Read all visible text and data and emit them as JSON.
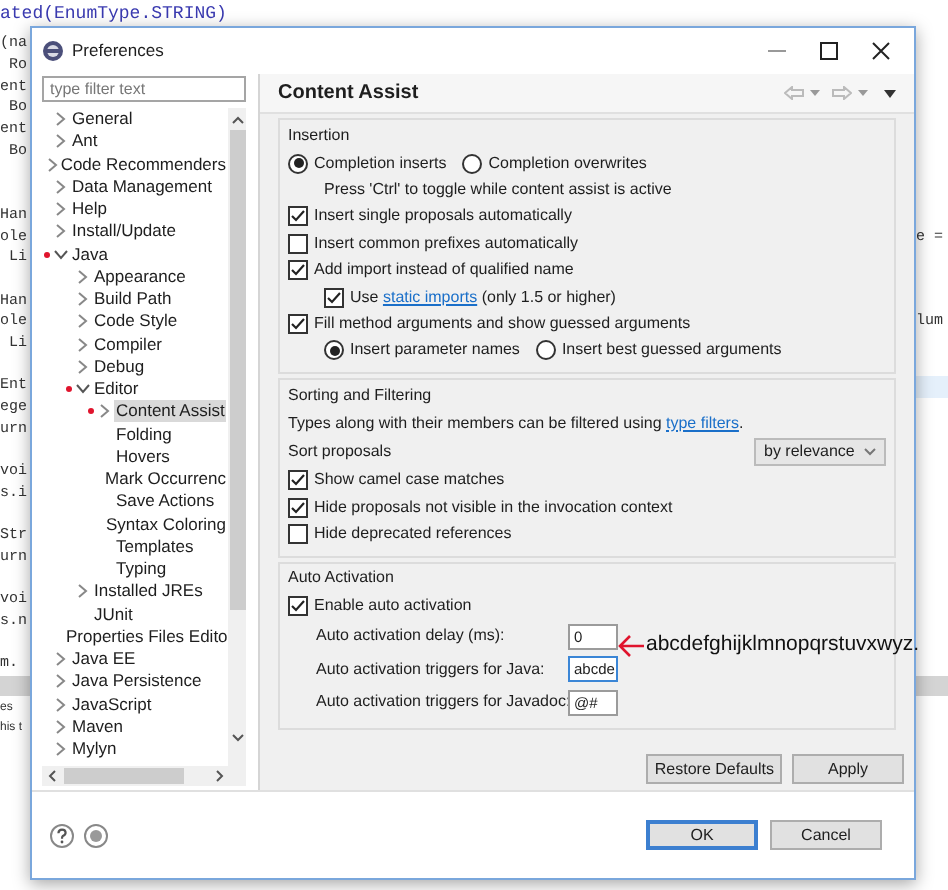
{
  "background": {
    "top_line": "ated(EnumType.STRING)",
    "left_lines": [
      {
        "kind": "code",
        "text": "(na"
      },
      {
        "kind": "code",
        "text": " Ro"
      },
      {
        "kind": "code",
        "text": "ent"
      },
      {
        "kind": "code",
        "text": " Bo"
      },
      {
        "kind": "code",
        "text": "ent"
      },
      {
        "kind": "code",
        "text": " Bo"
      },
      {
        "kind": "blank"
      },
      {
        "kind": "blank"
      },
      {
        "kind": "code",
        "text": "Han"
      },
      {
        "kind": "code",
        "text": "ole"
      },
      {
        "kind": "code",
        "text": " Li"
      },
      {
        "kind": "blank"
      },
      {
        "kind": "code",
        "text": "Han"
      },
      {
        "kind": "code",
        "text": "ole"
      },
      {
        "kind": "code",
        "text": " Li"
      },
      {
        "kind": "blank"
      },
      {
        "kind": "code",
        "text": "Ent"
      },
      {
        "kind": "code",
        "text": "ege"
      },
      {
        "kind": "code",
        "text": "urn"
      },
      {
        "kind": "blank"
      },
      {
        "kind": "code",
        "text": "voi"
      },
      {
        "kind": "code",
        "text": "s.i"
      },
      {
        "kind": "blank"
      },
      {
        "kind": "code",
        "text": "Str"
      },
      {
        "kind": "code",
        "text": "urn"
      },
      {
        "kind": "blank"
      },
      {
        "kind": "code",
        "text": "voi"
      },
      {
        "kind": "code",
        "text": "s.n"
      },
      {
        "kind": "blank"
      },
      {
        "kind": "code",
        "text": "m."
      },
      {
        "kind": "band"
      },
      {
        "kind": "ui",
        "text": "es"
      },
      {
        "kind": "ui",
        "text": "his t"
      }
    ],
    "right_lines": [
      {
        "kind": "blank"
      },
      {
        "kind": "blank"
      },
      {
        "kind": "blank"
      },
      {
        "kind": "blank"
      },
      {
        "kind": "blank"
      },
      {
        "kind": "blank"
      },
      {
        "kind": "blank"
      },
      {
        "kind": "blank"
      },
      {
        "kind": "blank"
      },
      {
        "kind": "code",
        "text": "e ="
      },
      {
        "kind": "blank"
      },
      {
        "kind": "blank"
      },
      {
        "kind": "blank"
      },
      {
        "kind": "code",
        "text": "lum"
      },
      {
        "kind": "blank"
      },
      {
        "kind": "blank"
      },
      {
        "kind": "highlight"
      },
      {
        "kind": "blank"
      },
      {
        "kind": "blank"
      },
      {
        "kind": "blank"
      },
      {
        "kind": "blank"
      },
      {
        "kind": "blank"
      },
      {
        "kind": "blank"
      },
      {
        "kind": "blank"
      },
      {
        "kind": "blank"
      },
      {
        "kind": "blank"
      },
      {
        "kind": "blank"
      },
      {
        "kind": "blank"
      },
      {
        "kind": "blank"
      },
      {
        "kind": "blank"
      },
      {
        "kind": "band"
      }
    ]
  },
  "window": {
    "title": "Preferences"
  },
  "filter": {
    "placeholder": "type filter text"
  },
  "tree": [
    {
      "label": "General",
      "has_children": true,
      "modified": false,
      "selected": false
    },
    {
      "label": "Ant",
      "has_children": true,
      "modified": false,
      "selected": false
    },
    {
      "label": "Code Recommenders",
      "has_children": true,
      "modified": false,
      "selected": false
    },
    {
      "label": "Data Management",
      "has_children": true,
      "modified": false,
      "selected": false
    },
    {
      "label": "Help",
      "has_children": true,
      "modified": false,
      "selected": false
    },
    {
      "label": "Install/Update",
      "has_children": true,
      "modified": false,
      "selected": false
    },
    {
      "label": "Java",
      "has_children": true,
      "expanded": true,
      "modified": true,
      "selected": false,
      "children": [
        {
          "label": "Appearance",
          "has_children": true,
          "modified": false,
          "selected": false
        },
        {
          "label": "Build Path",
          "has_children": true,
          "modified": false,
          "selected": false
        },
        {
          "label": "Code Style",
          "has_children": true,
          "modified": false,
          "selected": false
        },
        {
          "label": "Compiler",
          "has_children": true,
          "modified": false,
          "selected": false
        },
        {
          "label": "Debug",
          "has_children": true,
          "modified": false,
          "selected": false
        },
        {
          "label": "Editor",
          "has_children": true,
          "expanded": true,
          "modified": true,
          "selected": false,
          "children": [
            {
              "label": "Content Assist",
              "has_children": true,
              "modified": true,
              "selected": true
            },
            {
              "label": "Folding",
              "has_children": false,
              "modified": false,
              "selected": false
            },
            {
              "label": "Hovers",
              "has_children": false,
              "modified": false,
              "selected": false
            },
            {
              "label": "Mark Occurrenc",
              "has_children": false,
              "modified": false,
              "selected": false
            },
            {
              "label": "Save Actions",
              "has_children": false,
              "modified": false,
              "selected": false
            },
            {
              "label": "Syntax Coloring",
              "has_children": false,
              "modified": false,
              "selected": false
            },
            {
              "label": "Templates",
              "has_children": false,
              "modified": false,
              "selected": false
            },
            {
              "label": "Typing",
              "has_children": false,
              "modified": false,
              "selected": false
            }
          ]
        },
        {
          "label": "Installed JREs",
          "has_children": true,
          "modified": false,
          "selected": false
        },
        {
          "label": "JUnit",
          "has_children": false,
          "modified": false,
          "selected": false
        },
        {
          "label": "Properties Files Edito",
          "has_children": false,
          "modified": false,
          "selected": false
        }
      ]
    },
    {
      "label": "Java EE",
      "has_children": true,
      "modified": false,
      "selected": false
    },
    {
      "label": "Java Persistence",
      "has_children": true,
      "modified": false,
      "selected": false
    },
    {
      "label": "JavaScript",
      "has_children": true,
      "modified": false,
      "selected": false
    },
    {
      "label": "Maven",
      "has_children": true,
      "modified": false,
      "selected": false
    },
    {
      "label": "Mylyn",
      "has_children": true,
      "modified": false,
      "selected": false
    }
  ],
  "page_title": "Content Assist",
  "groups": [
    {
      "title": "Insertion",
      "items": [
        {
          "kind": "radios",
          "options": [
            {
              "label": "Completion inserts",
              "selected": true
            },
            {
              "label": "Completion overwrites",
              "selected": false
            }
          ]
        },
        {
          "kind": "note",
          "text": "Press 'Ctrl' to toggle while content assist is active"
        },
        {
          "kind": "checkbox",
          "label": "Insert single proposals automatically",
          "checked": true
        },
        {
          "kind": "checkbox",
          "label": "Insert common prefixes automatically",
          "checked": false
        },
        {
          "kind": "checkbox",
          "label": "Add import instead of qualified name",
          "checked": true
        },
        {
          "kind": "link_checkbox",
          "before": "Use",
          "link": "static imports",
          "after": "(only 1.5 or higher)",
          "checked": true
        },
        {
          "kind": "checkbox",
          "label": "Fill method arguments and show guessed arguments",
          "checked": true
        },
        {
          "kind": "sub_radios",
          "options": [
            {
              "label": "Insert parameter names",
              "selected": true
            },
            {
              "label": "Insert best guessed arguments",
              "selected": false
            }
          ]
        }
      ]
    },
    {
      "title": "Sorting and Filtering",
      "items": [
        {
          "kind": "link_text",
          "before": "Types along with their members can be filtered using",
          "link": "type filters",
          "after": "."
        },
        {
          "kind": "select",
          "label": "Sort proposals",
          "value": "by relevance"
        },
        {
          "kind": "checkbox",
          "label": "Show camel case matches",
          "checked": true
        },
        {
          "kind": "checkbox",
          "label": "Hide proposals not visible in the invocation context",
          "checked": true
        },
        {
          "kind": "checkbox",
          "label": "Hide deprecated references",
          "checked": false
        }
      ]
    },
    {
      "title": "Auto Activation",
      "items": [
        {
          "kind": "checkbox",
          "label": "Enable auto activation",
          "checked": true
        },
        {
          "kind": "field",
          "label": "Auto activation delay (ms):",
          "value": "0",
          "focused": false
        },
        {
          "kind": "field",
          "label": "Auto activation triggers for Java:",
          "value": "abcde",
          "focused": true
        },
        {
          "kind": "field",
          "label": "Auto activation triggers for Javadoc:",
          "value": "@#",
          "focused": false
        }
      ]
    }
  ],
  "page_buttons": [
    "Restore Defaults",
    "Apply"
  ],
  "dialog_buttons": [
    {
      "label": "OK",
      "default": true
    },
    {
      "label": "Cancel",
      "default": false
    }
  ],
  "annotation": "abcdefghijklmnopqrstuvxwyz."
}
